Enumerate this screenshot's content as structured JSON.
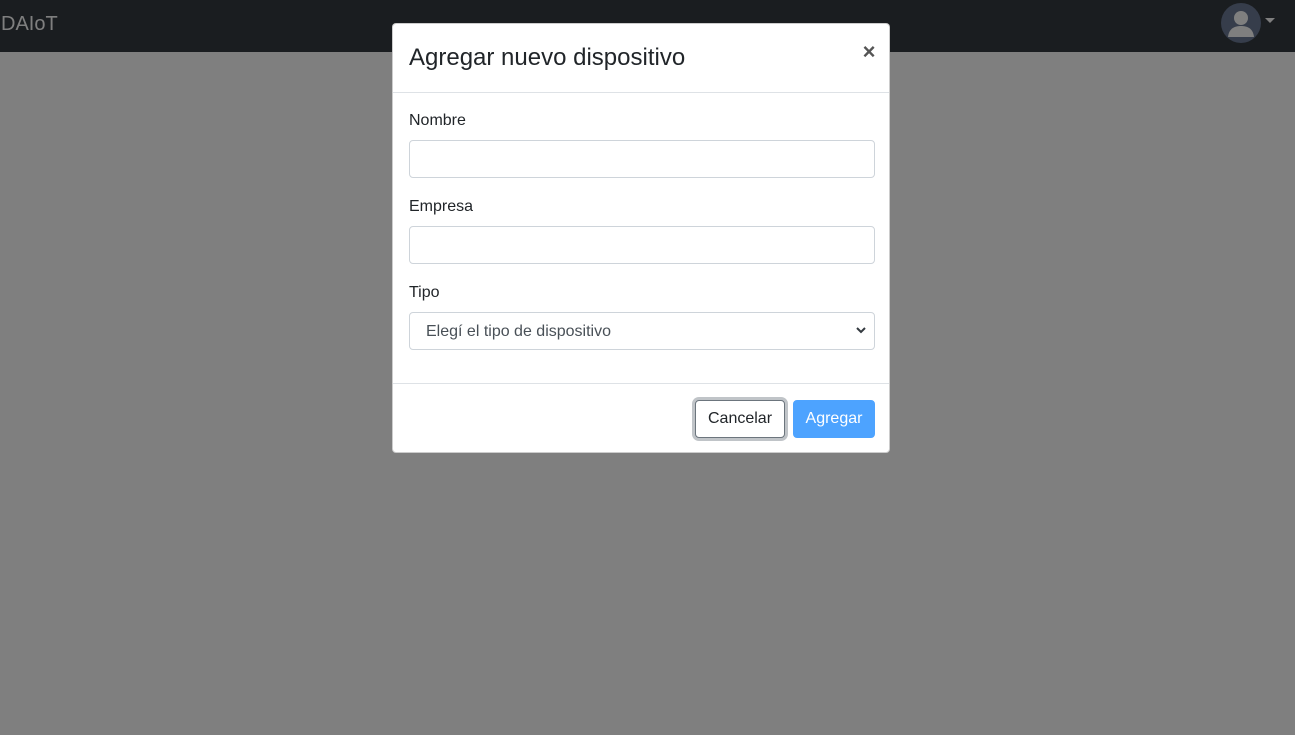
{
  "navbar": {
    "brand": "DAIoT",
    "user_icon": "user-avatar-icon",
    "dropdown_icon": "caret-down-icon"
  },
  "modal": {
    "title": "Agregar nuevo dispositivo",
    "close_label": "×",
    "fields": {
      "nombre": {
        "label": "Nombre",
        "value": "",
        "placeholder": ""
      },
      "empresa": {
        "label": "Empresa",
        "value": "",
        "placeholder": ""
      },
      "tipo": {
        "label": "Tipo",
        "selected": "Elegí el tipo de dispositivo"
      }
    },
    "buttons": {
      "cancel": "Cancelar",
      "add": "Agregar"
    }
  },
  "colors": {
    "navbar_bg": "#343a40",
    "primary_button": "#4da3ff",
    "backdrop": "rgba(0,0,0,0.5)"
  }
}
